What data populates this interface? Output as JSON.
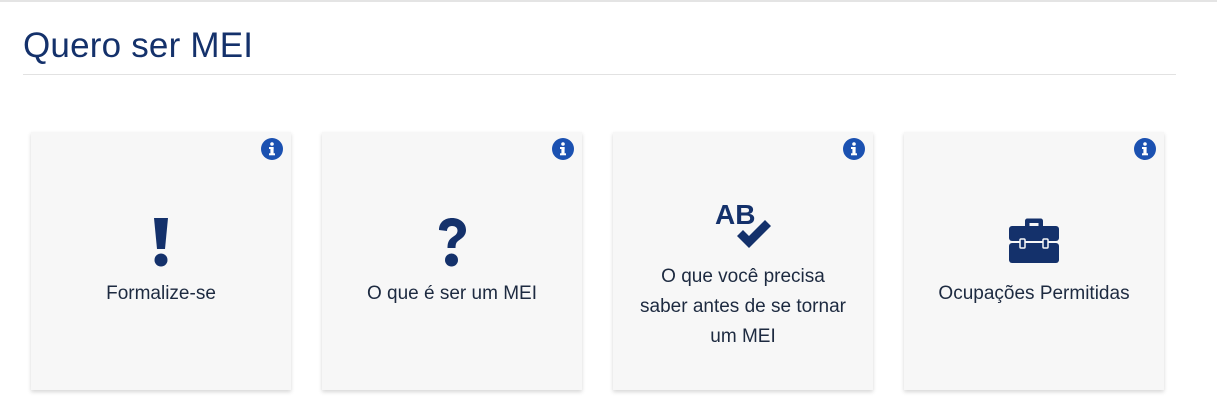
{
  "page": {
    "title": "Quero ser MEI"
  },
  "colors": {
    "brand": "#14316b",
    "info": "#1b51b1",
    "card_bg": "#f7f7f7"
  },
  "cards": [
    {
      "label": "Formalize-se",
      "icon": "exclamation-icon"
    },
    {
      "label": "O que é ser um MEI",
      "icon": "question-icon"
    },
    {
      "label": "O que você precisa saber antes de se tornar um MEI",
      "icon": "spell-check-icon",
      "icon_text": "AB"
    },
    {
      "label": "Ocupações Permitidas",
      "icon": "toolbox-icon"
    }
  ]
}
